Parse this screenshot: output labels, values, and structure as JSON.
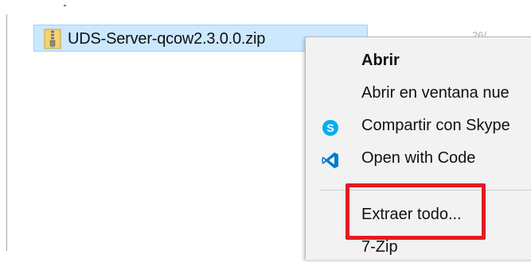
{
  "file": {
    "name": "UDS-Server-qcow2.3.0.0.zip",
    "meta": "26/",
    "icon": "zip-folder-icon"
  },
  "context_menu": {
    "items": [
      {
        "label": "Abrir",
        "bold": true,
        "icon": ""
      },
      {
        "label": "Abrir en ventana nue",
        "bold": false,
        "icon": ""
      },
      {
        "label": "Compartir con Skype",
        "bold": false,
        "icon": "skype-icon"
      },
      {
        "label": "Open with Code",
        "bold": false,
        "icon": "vscode-icon"
      },
      {
        "label": "Extraer todo...",
        "bold": false,
        "icon": ""
      },
      {
        "label": "7-Zip",
        "bold": false,
        "icon": ""
      }
    ]
  },
  "colors": {
    "selection": "#cce8ff",
    "highlight": "#e31b23",
    "skype": "#00aff0",
    "vscode": "#0065a9"
  }
}
